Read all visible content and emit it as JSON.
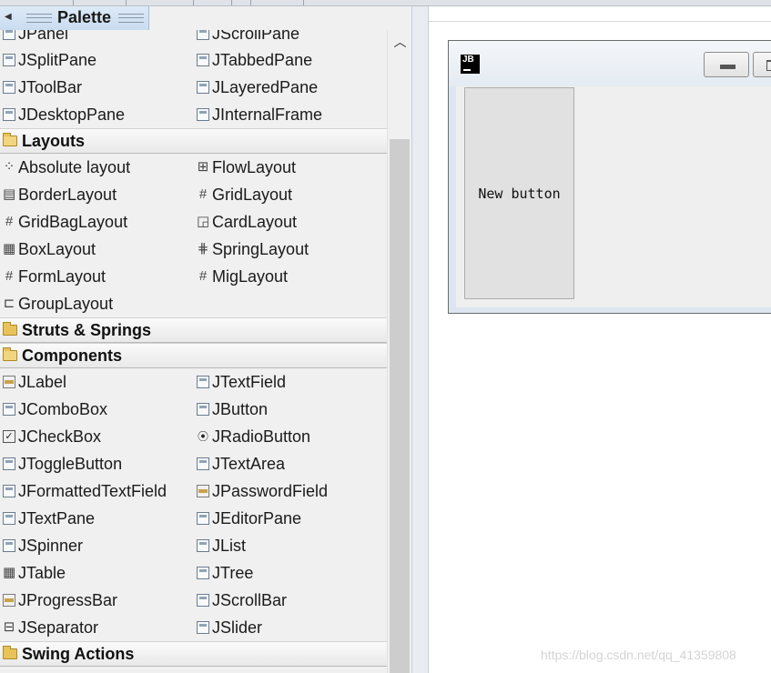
{
  "palette": {
    "title": "Palette",
    "collapse_icon": "left-arrow-icon",
    "rows": [
      {
        "left": "JPanel",
        "right": "JScrollPane"
      },
      {
        "left": "JSplitPane",
        "right": "JTabbedPane"
      },
      {
        "left": "JToolBar",
        "right": "JLayeredPane"
      },
      {
        "left": "JDesktopPane",
        "right": "JInternalFrame"
      }
    ],
    "categories": {
      "layouts": "Layouts",
      "struts": "Struts & Springs",
      "components": "Components",
      "swing_actions": "Swing Actions"
    },
    "layouts": [
      {
        "left": "Absolute layout",
        "right": "FlowLayout"
      },
      {
        "left": "BorderLayout",
        "right": "GridLayout"
      },
      {
        "left": "GridBagLayout",
        "right": "CardLayout"
      },
      {
        "left": "BoxLayout",
        "right": "SpringLayout"
      },
      {
        "left": "FormLayout",
        "right": "MigLayout"
      },
      {
        "left": "GroupLayout",
        "right": ""
      }
    ],
    "components": [
      {
        "left": "JLabel",
        "right": "JTextField"
      },
      {
        "left": "JComboBox",
        "right": "JButton"
      },
      {
        "left": "JCheckBox",
        "right": "JRadioButton"
      },
      {
        "left": "JToggleButton",
        "right": "JTextArea"
      },
      {
        "left": "JFormattedTextField",
        "right": "JPasswordField"
      },
      {
        "left": "JTextPane",
        "right": "JEditorPane"
      },
      {
        "left": "JSpinner",
        "right": "JList"
      },
      {
        "left": "JTable",
        "right": "JTree"
      },
      {
        "left": "JProgressBar",
        "right": "JScrollBar"
      },
      {
        "left": "JSeparator",
        "right": "JSlider"
      }
    ]
  },
  "design": {
    "frame_logo": "JB",
    "button_label": "New button"
  },
  "watermark": "https://blog.csdn.net/qq_41359808"
}
